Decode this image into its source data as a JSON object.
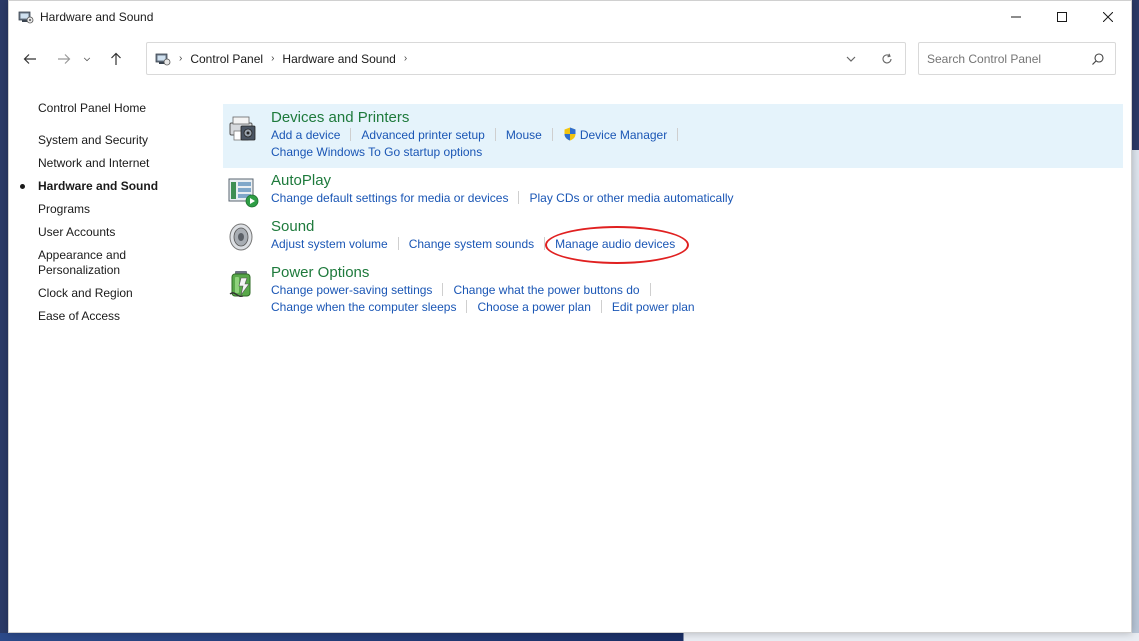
{
  "window": {
    "title": "Hardware and Sound"
  },
  "address": {
    "crumbs": [
      "Control Panel",
      "Hardware and Sound"
    ]
  },
  "search": {
    "placeholder": "Search Control Panel"
  },
  "leftpane": {
    "home": "Control Panel Home",
    "items": [
      {
        "label": "System and Security"
      },
      {
        "label": "Network and Internet"
      },
      {
        "label": "Hardware and Sound",
        "current": true
      },
      {
        "label": "Programs"
      },
      {
        "label": "User Accounts"
      },
      {
        "label": "Appearance and Personalization"
      },
      {
        "label": "Clock and Region"
      },
      {
        "label": "Ease of Access"
      }
    ]
  },
  "categories": [
    {
      "title": "Devices and Printers",
      "icon": "printer-icon",
      "highlight": true,
      "links": [
        [
          "Add a device",
          "Advanced printer setup",
          "Mouse",
          "Device Manager"
        ],
        [
          "Change Windows To Go startup options"
        ]
      ]
    },
    {
      "title": "AutoPlay",
      "icon": "autoplay-icon",
      "links": [
        [
          "Change default settings for media or devices",
          "Play CDs or other media automatically"
        ]
      ]
    },
    {
      "title": "Sound",
      "icon": "speaker-icon",
      "links": [
        [
          "Adjust system volume",
          "Change system sounds",
          "Manage audio devices"
        ]
      ]
    },
    {
      "title": "Power Options",
      "icon": "battery-icon",
      "links": [
        [
          "Change power-saving settings",
          "Change what the power buttons do"
        ],
        [
          "Change when the computer sleeps",
          "Choose a power plan",
          "Edit power plan"
        ]
      ]
    }
  ],
  "colors": {
    "category_title": "#1e7a3c",
    "link": "#1a56b5",
    "highlight_bg": "#e5f3fb",
    "annotation": "#e02020"
  }
}
